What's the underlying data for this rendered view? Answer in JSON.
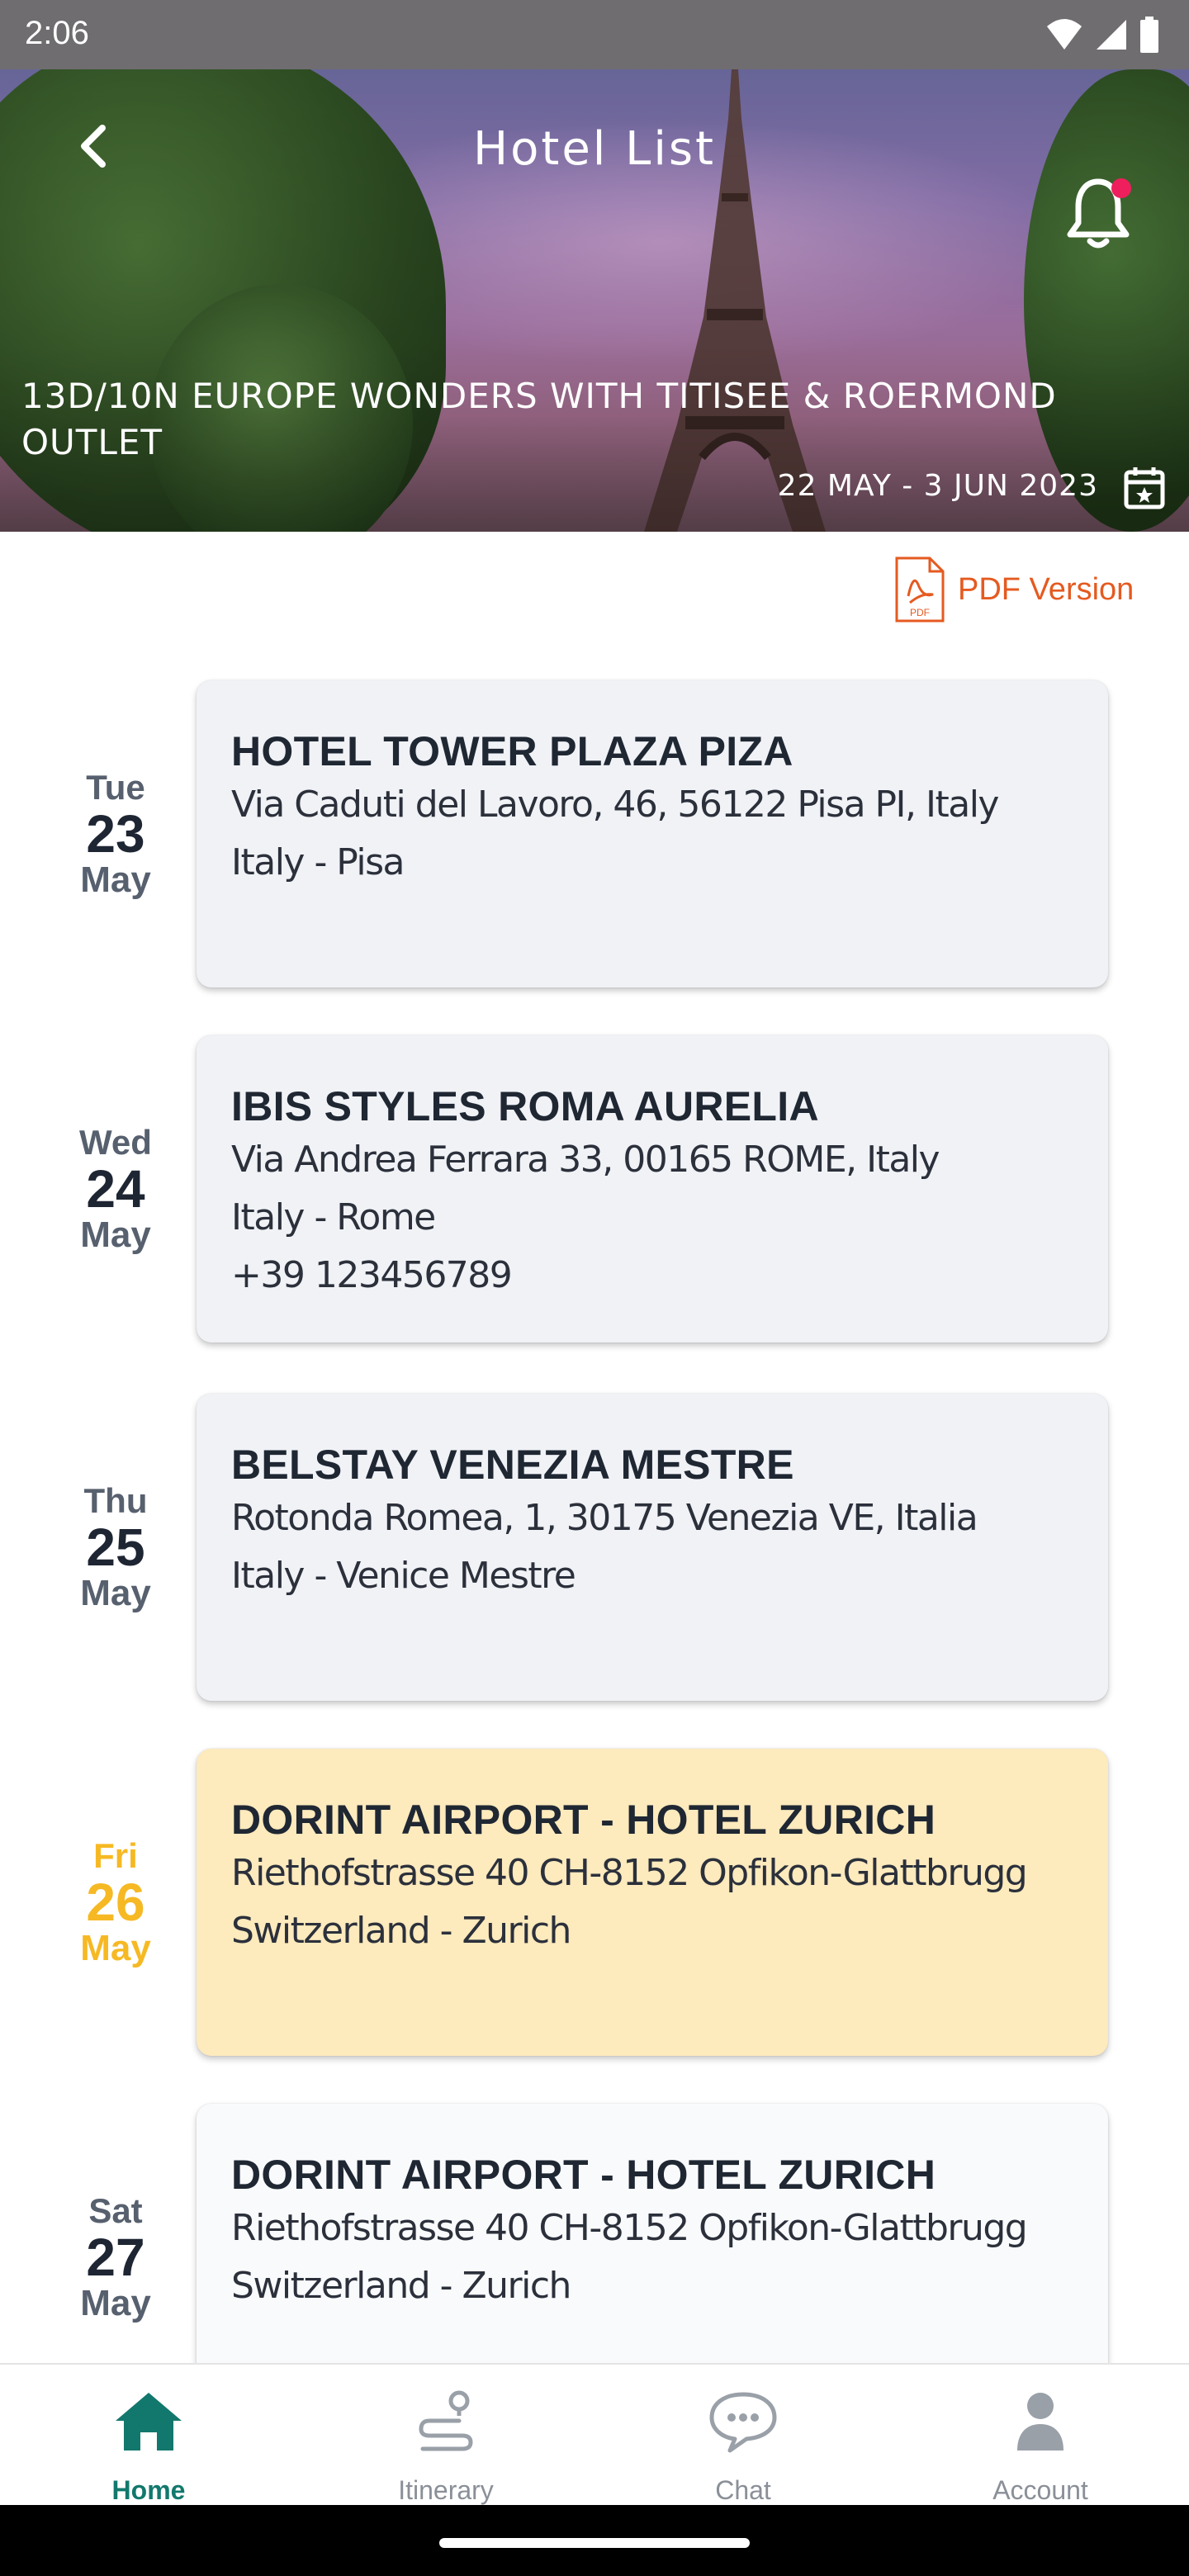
{
  "status_bar": {
    "time": "2:06"
  },
  "header": {
    "title": "Hotel List",
    "tour_title": "13D/10N EUROPE WONDERS WITH TITISEE & ROERMOND OUTLET",
    "tour_dates": "22 MAY - 3 JUN 2023"
  },
  "pdf": {
    "label": "PDF Version"
  },
  "hotels": [
    {
      "dow": "Tue",
      "day": "23",
      "month": "May",
      "name": "HOTEL TOWER PLAZA PIZA",
      "address": "Via Caduti del Lavoro, 46, 56122 Pisa PI, Italy",
      "location": "Italy - Pisa",
      "phone": ""
    },
    {
      "dow": "Wed",
      "day": "24",
      "month": "May",
      "name": "IBIS STYLES ROMA AURELIA",
      "address": "Via Andrea Ferrara 33, 00165 ROME, Italy",
      "location": "Italy - Rome",
      "phone": "+39 123456789"
    },
    {
      "dow": "Thu",
      "day": "25",
      "month": "May",
      "name": "BELSTAY VENEZIA MESTRE",
      "address": "Rotonda Romea, 1, 30175 Venezia VE, Italia",
      "location": "Italy - Venice Mestre",
      "phone": ""
    },
    {
      "dow": "Fri",
      "day": "26",
      "month": "May",
      "name": "DORINT AIRPORT - HOTEL ZURICH",
      "address": "Riethofstrasse 40 CH-8152 Opfikon-Glattbrugg",
      "location": "Switzerland - Zurich",
      "phone": ""
    },
    {
      "dow": "Sat",
      "day": "27",
      "month": "May",
      "name": "DORINT AIRPORT - HOTEL ZURICH",
      "address": "Riethofstrasse 40 CH-8152 Opfikon-Glattbrugg",
      "location": "Switzerland - Zurich",
      "phone": ""
    }
  ],
  "highlight_color": "#f6b924",
  "active_card_color": "#fdeabd",
  "accent_color": "#12786d",
  "pdf_color": "#e55a20",
  "bottom_nav": {
    "items": [
      {
        "label": "Home",
        "icon": "home-icon",
        "active": true
      },
      {
        "label": "Itinerary",
        "icon": "route-icon",
        "active": false
      },
      {
        "label": "Chat",
        "icon": "chat-icon",
        "active": false
      },
      {
        "label": "Account",
        "icon": "account-icon",
        "active": false
      }
    ]
  }
}
